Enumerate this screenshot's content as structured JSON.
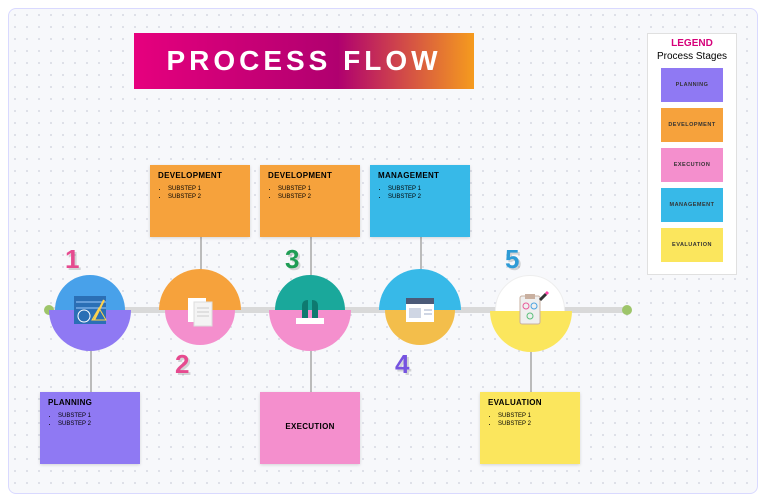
{
  "title": "PROCESS FLOW",
  "legend": {
    "title": "LEGEND",
    "subtitle": "Process Stages",
    "items": [
      {
        "label": "PLANNING",
        "color": "#8f79f3"
      },
      {
        "label": "DEVELOPMENT",
        "color": "#f6a23c"
      },
      {
        "label": "EXECUTION",
        "color": "#f48fcd"
      },
      {
        "label": "MANAGEMENT",
        "color": "#37b9e8"
      },
      {
        "label": "EVALUATION",
        "color": "#fbe65d"
      }
    ]
  },
  "steps": {
    "1": {
      "number": "1",
      "numColor": "#e64a8f",
      "circleBg": "#48a1ea",
      "arcColor": "#8f79f3",
      "arcSide": "bottom"
    },
    "2": {
      "number": "2",
      "numColor": "#e64a8f",
      "circleBg": "#f48fcd",
      "arcColor": "#f6a23c",
      "arcSide": "top"
    },
    "3": {
      "number": "3",
      "numColor": "#1f9d55",
      "circleBg": "#1aa89b",
      "arcColor": "#f48fcd",
      "arcSide": "bottom"
    },
    "4": {
      "number": "4",
      "numColor": "#7653e0",
      "circleBg": "#f3be4b",
      "arcColor": "#37b9e8",
      "arcSide": "top"
    },
    "5": {
      "number": "5",
      "numColor": "#2e9bd6",
      "circleBg": "#ffffff",
      "arcColor": "#fbe65d",
      "arcSide": "bottom"
    }
  },
  "boxes": {
    "planning": {
      "title": "PLANNING",
      "items": [
        "SUBSTEP 1",
        "SUBSTEP 2"
      ]
    },
    "dev1": {
      "title": "DEVELOPMENT",
      "items": [
        "SUBSTEP 1",
        "SUBSTEP 2"
      ]
    },
    "dev2": {
      "title": "DEVELOPMENT",
      "items": [
        "SUBSTEP 1",
        "SUBSTEP 2"
      ]
    },
    "execution": {
      "title": "EXECUTION",
      "items": []
    },
    "management": {
      "title": "MANAGEMENT",
      "items": [
        "SUBSTEP 1",
        "SUBSTEP 2"
      ]
    },
    "evaluation": {
      "title": "EVALUATION",
      "items": [
        "SUBSTEP 1",
        "SUBSTEP 2"
      ]
    }
  }
}
